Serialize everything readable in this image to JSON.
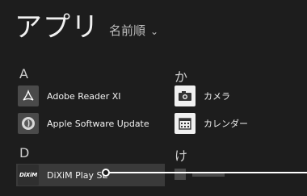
{
  "header": {
    "title": "アプリ",
    "sort_label": "名前順",
    "sort_chevron": "⌄"
  },
  "groups": {
    "a": {
      "letter": "A"
    },
    "ka": {
      "letter": "か"
    },
    "d": {
      "letter": "D"
    },
    "ke": {
      "letter": "け"
    }
  },
  "apps": {
    "adobe": {
      "label": "Adobe Reader XI",
      "icon": "adobe-reader-icon"
    },
    "apple": {
      "label": "Apple Software Update",
      "icon": "apple-update-icon"
    },
    "camera": {
      "label": "カメラ",
      "icon": "camera-icon"
    },
    "calendar": {
      "label": "カレンダー",
      "icon": "calendar-icon"
    },
    "dixim": {
      "label": "DiXiM Play SE",
      "icon": "dixim-icon",
      "icon_text": "DiXiM"
    }
  },
  "colors": {
    "background": "#1d1d1d",
    "selected": "#3a3a3a",
    "text": "#f2f2f2"
  }
}
